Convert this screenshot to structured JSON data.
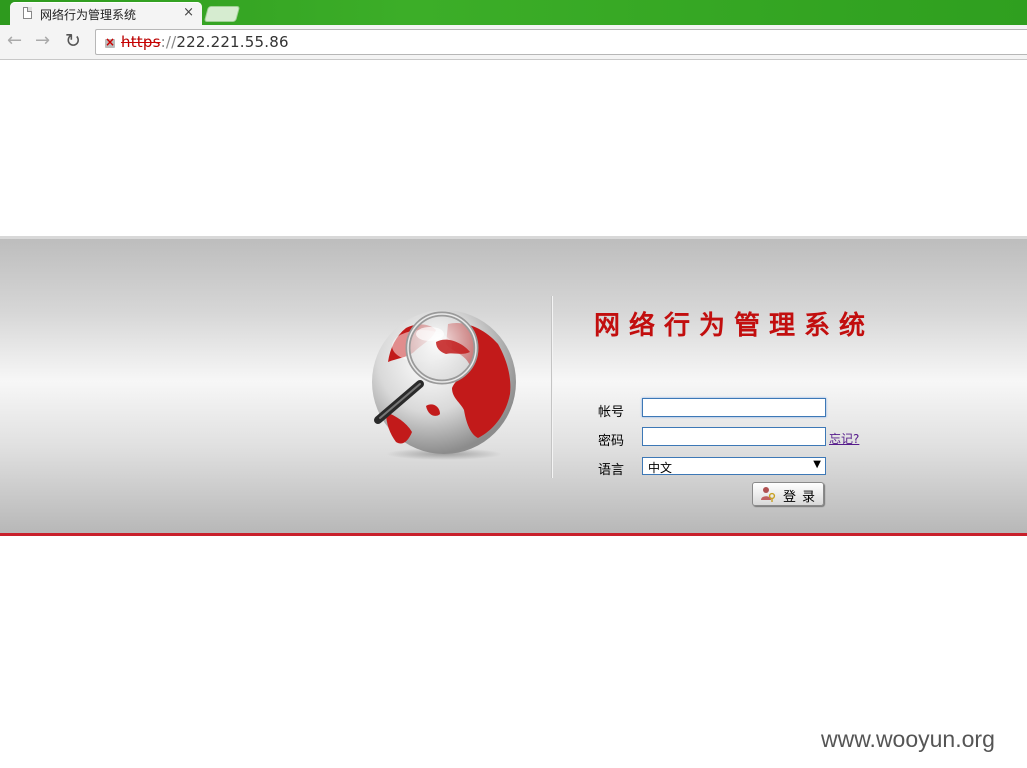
{
  "browser": {
    "tab_title": "网络行为管理系统",
    "tab_close": "×",
    "url_scheme": "https",
    "url_separator": "://",
    "url_host": "222.221.55.86",
    "back_icon": "arrow-left-icon",
    "forward_icon": "arrow-right-icon",
    "reload_icon": "reload-icon"
  },
  "login": {
    "system_title": "网络行为管理系统",
    "account_label": "帐号",
    "account_value": "",
    "password_label": "密码",
    "password_value": "",
    "forgot_link": "忘记?",
    "language_label": "语言",
    "language_selected": "中文",
    "login_button": "登录"
  },
  "watermark": "www.wooyun.org",
  "colors": {
    "title_red": "#c20e0e",
    "tab_strip_green": "#3cae28",
    "band_bottom_red": "#c8202b"
  }
}
